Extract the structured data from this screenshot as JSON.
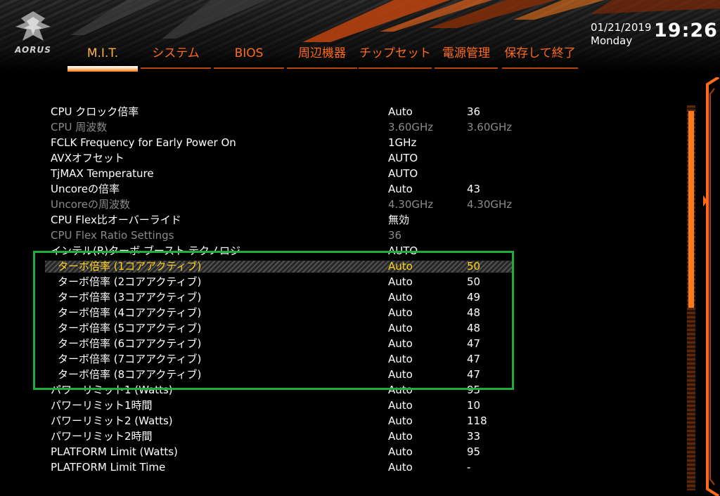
{
  "brand": {
    "logo_text": "AORUS"
  },
  "tabs": [
    {
      "label": "M.I.T.",
      "active": true
    },
    {
      "label": "システム",
      "active": false
    },
    {
      "label": "BIOS",
      "active": false
    },
    {
      "label": "周辺機器",
      "active": false
    },
    {
      "label": "チップセット",
      "active": false
    },
    {
      "label": "電源管理",
      "active": false
    },
    {
      "label": "保存して終了",
      "active": false
    }
  ],
  "datetime": {
    "date": "01/21/2019",
    "day": "Monday",
    "time": "19:26"
  },
  "settings": [
    {
      "label": "CPU クロック倍率",
      "value": "Auto",
      "value2": "36",
      "state": "normal"
    },
    {
      "label": "CPU 周波数",
      "value": "3.60GHz",
      "value2": "3.60GHz",
      "state": "dim"
    },
    {
      "label": "FCLK Frequency for Early Power On",
      "value": "1GHz",
      "value2": "",
      "state": "normal"
    },
    {
      "label": "AVXオフセット",
      "value": "AUTO",
      "value2": "",
      "state": "normal"
    },
    {
      "label": "TjMAX Temperature",
      "value": "AUTO",
      "value2": "",
      "state": "normal"
    },
    {
      "label": "Uncoreの倍率",
      "value": "Auto",
      "value2": "43",
      "state": "normal"
    },
    {
      "label": "Uncoreの周波数",
      "value": "4.30GHz",
      "value2": "4.30GHz",
      "state": "dim"
    },
    {
      "label": "CPU Flex比オーバーライド",
      "value": "無効",
      "value2": "",
      "state": "normal"
    },
    {
      "label": "CPU Flex Ratio Settings",
      "value": "36",
      "value2": "",
      "state": "dim"
    },
    {
      "label": "インテル(R)ターボ ブースト テクノロジ",
      "value": "AUTO",
      "value2": "",
      "state": "normal"
    },
    {
      "label": "ターボ倍率 (1コアアクティブ)",
      "value": "Auto",
      "value2": "50",
      "state": "selected",
      "sub": true
    },
    {
      "label": "ターボ倍率 (2コアアクティブ)",
      "value": "Auto",
      "value2": "50",
      "state": "normal",
      "sub": true
    },
    {
      "label": "ターボ倍率 (3コアアクティブ)",
      "value": "Auto",
      "value2": "49",
      "state": "normal",
      "sub": true
    },
    {
      "label": "ターボ倍率 (4コアアクティブ)",
      "value": "Auto",
      "value2": "48",
      "state": "normal",
      "sub": true
    },
    {
      "label": "ターボ倍率 (5コアアクティブ)",
      "value": "Auto",
      "value2": "48",
      "state": "normal",
      "sub": true
    },
    {
      "label": "ターボ倍率 (6コアアクティブ)",
      "value": "Auto",
      "value2": "47",
      "state": "normal",
      "sub": true
    },
    {
      "label": "ターボ倍率 (7コアアクティブ)",
      "value": "Auto",
      "value2": "47",
      "state": "normal",
      "sub": true
    },
    {
      "label": "ターボ倍率 (8コアアクティブ)",
      "value": "Auto",
      "value2": "47",
      "state": "normal",
      "sub": true
    },
    {
      "label": "パワーリミット1 (Watts)",
      "value": "Auto",
      "value2": "95",
      "state": "normal"
    },
    {
      "label": "パワーリミット1時間",
      "value": "Auto",
      "value2": "10",
      "state": "normal"
    },
    {
      "label": "パワーリミット2 (Watts)",
      "value": "Auto",
      "value2": "118",
      "state": "normal"
    },
    {
      "label": "パワーリミット2時間",
      "value": "Auto",
      "value2": "33",
      "state": "normal"
    },
    {
      "label": "PLATFORM Limit (Watts)",
      "value": "Auto",
      "value2": "95",
      "state": "normal"
    },
    {
      "label": "PLATFORM Limit Time",
      "value": "Auto",
      "value2": "-",
      "state": "normal"
    }
  ],
  "colors": {
    "accent_orange": "#ff6a1a",
    "selected_text": "#ffd11a",
    "dim_text": "#8a8a8a",
    "highlight_box": "#1fae3a"
  },
  "icons": {
    "logo": "aorus-eagle-icon",
    "scroll_arrow": "chevron-right-icon"
  }
}
